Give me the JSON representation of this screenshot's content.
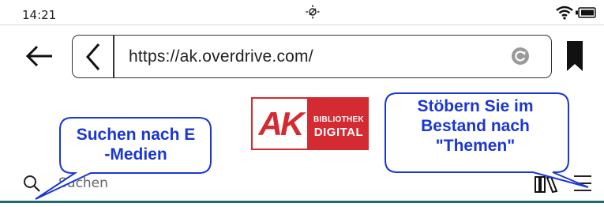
{
  "status_bar": {
    "time": "14:21",
    "icons": [
      "brightness-icon",
      "wifi-icon",
      "battery-icon"
    ]
  },
  "browser": {
    "url": "https://ak.overdrive.com/"
  },
  "logo": {
    "left_text": "AK",
    "right_line1": "BIBLIOTHEK",
    "right_line2": "DIGITAL",
    "brand_color": "#d42a31"
  },
  "search": {
    "placeholder": "Suchen"
  },
  "callouts": {
    "left": {
      "line1": "Suchen nach E",
      "line2": "-Medien"
    },
    "right": {
      "line1": "Stöbern Sie im",
      "line2": "Bestand nach",
      "line3": "\"Themen\""
    },
    "color": "#1a37d1"
  },
  "accent_color": "#1d6b73"
}
